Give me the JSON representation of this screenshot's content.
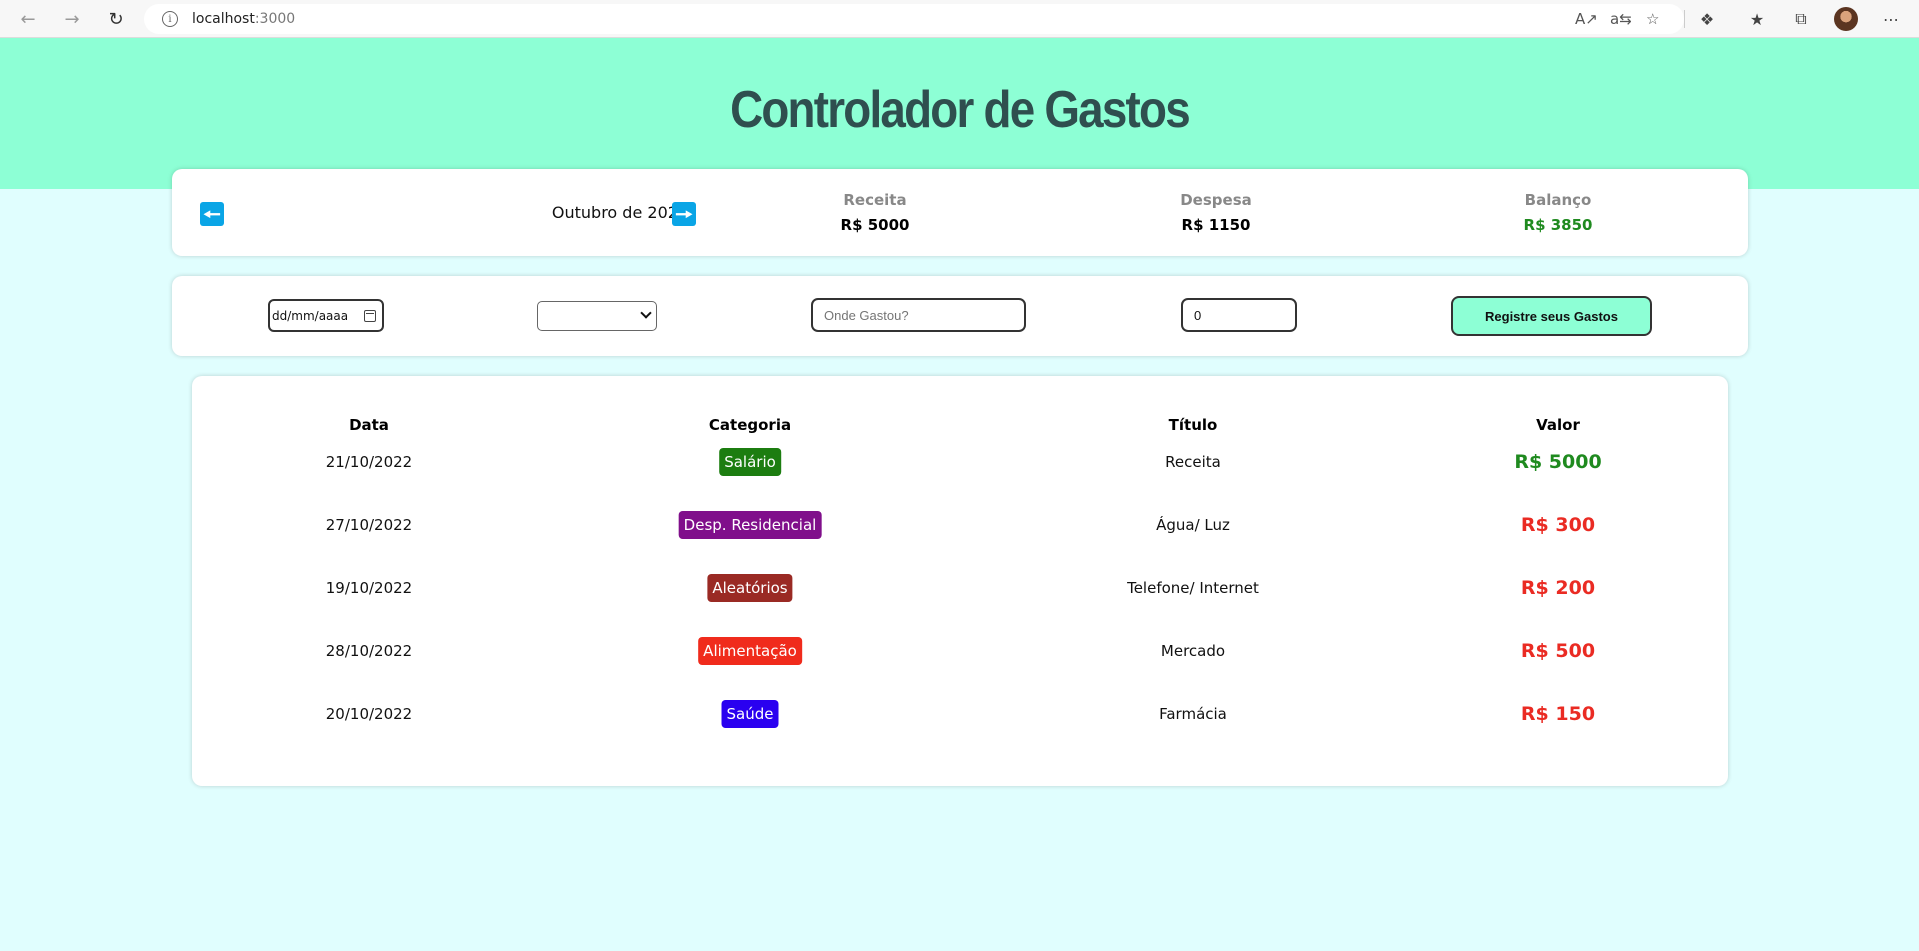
{
  "browser": {
    "url_host": "localhost",
    "url_port": ":3000"
  },
  "app": {
    "title": "Controlador de Gastos"
  },
  "info": {
    "month": "Outubro de 2022",
    "summary": [
      {
        "label": "Receita",
        "value": "R$ 5000"
      },
      {
        "label": "Despesa",
        "value": "R$ 1150"
      },
      {
        "label": "Balanço",
        "value": "R$ 3850"
      }
    ]
  },
  "form": {
    "date_placeholder": "dd/mm/aaaa",
    "category_selected": "",
    "title_placeholder": "Onde Gastou?",
    "value": "0",
    "submit_label": "Registre seus Gastos"
  },
  "table": {
    "headers": [
      "Data",
      "Categoria",
      "Título",
      "Valor"
    ],
    "rows": [
      {
        "date": "21/10/2022",
        "category": "Salário",
        "title": "Receita",
        "value": "R$ 5000"
      },
      {
        "date": "27/10/2022",
        "category": "Desp. Residencial",
        "title": "Água/ Luz",
        "value": "R$ 300"
      },
      {
        "date": "19/10/2022",
        "category": "Aleatórios",
        "title": "Telefone/ Internet",
        "value": "R$ 200"
      },
      {
        "date": "28/10/2022",
        "category": "Alimentação",
        "title": "Mercado",
        "value": "R$ 500"
      },
      {
        "date": "20/10/2022",
        "category": "Saúde",
        "title": "Farmácia",
        "value": "R$ 150"
      }
    ]
  },
  "colors": {
    "header_band": "#8dffd5",
    "page_bg": "#e0fefe",
    "arrow_button": "#0aa5e6",
    "income": "#1f8a1f",
    "expense": "#ea2b23",
    "badge_salario": "#1c7d10",
    "badge_residencial": "#800f8b",
    "badge_aleatorios": "#9a2a24",
    "badge_alimentacao": "#f02b1c",
    "badge_saude": "#2a00f0"
  }
}
